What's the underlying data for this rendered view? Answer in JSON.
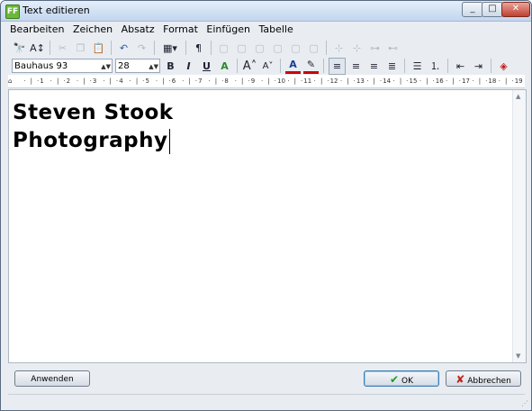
{
  "window": {
    "title": "Text editieren",
    "app_icon": "FF"
  },
  "menu": [
    "Bearbeiten",
    "Zeichen",
    "Absatz",
    "Format",
    "Einfügen",
    "Tabelle"
  ],
  "font": {
    "family": "Bauhaus 93",
    "size": "28"
  },
  "ruler": [
    "1",
    "2",
    "3",
    "4",
    "5",
    "6",
    "7",
    "8",
    "9",
    "10",
    "11",
    "12",
    "13",
    "14",
    "15",
    "16",
    "17",
    "18",
    "19"
  ],
  "document": {
    "line1": "Steven Stook",
    "line2": "Photography"
  },
  "buttons": {
    "apply": "Anwenden",
    "ok": "OK",
    "cancel": "Abbrechen"
  },
  "icons": {
    "find": "binoculars-icon",
    "replace": "find-replace-icon",
    "cut": "scissors-icon",
    "copy": "copy-icon",
    "paste": "paste-icon",
    "undo": "undo-icon",
    "redo": "redo-icon",
    "table": "table-icon",
    "pilcrow": "pilcrow-icon"
  },
  "colors": {
    "ok_check": "#1e9a1e",
    "cancel_x": "#c0201a",
    "font_color_bar": "#d00000",
    "highlight_bar": "#d00000"
  }
}
